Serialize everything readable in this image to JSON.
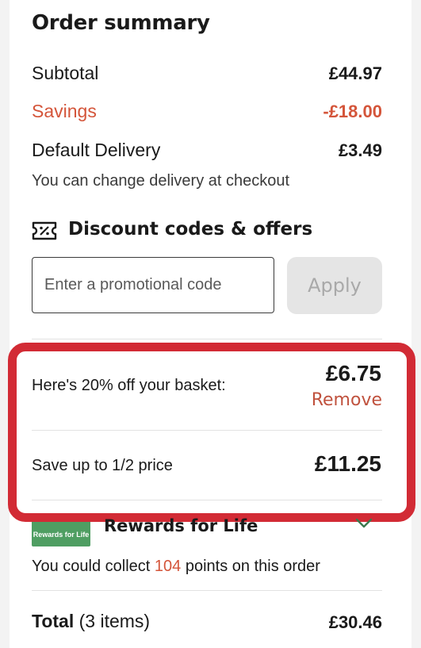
{
  "summary": {
    "title": "Order summary",
    "subtotal_label": "Subtotal",
    "subtotal_value": "£44.97",
    "savings_label": "Savings",
    "savings_value": "-£18.00",
    "delivery_label": "Default Delivery",
    "delivery_value": "£3.49",
    "delivery_note": "You can change delivery at checkout"
  },
  "discounts": {
    "title": "Discount codes & offers",
    "icon": "discount-ticket-icon",
    "promo_placeholder": "Enter a promotional code",
    "apply_label": "Apply"
  },
  "offers": [
    {
      "label": "Here's 20% off your basket:",
      "value": "£6.75",
      "action": "Remove"
    },
    {
      "label": "Save up to 1/2 price",
      "value": "£11.25"
    }
  ],
  "rewards": {
    "logo_text": "Rewards for Life",
    "title": "Rewards for Life",
    "points_prefix": "You could collect ",
    "points_value": "104",
    "points_suffix": " points on this order",
    "chevron_icon": "chevron-down-icon"
  },
  "total": {
    "label": "Total",
    "items": "(3 items)",
    "value": "£30.46"
  },
  "colors": {
    "savings": "#d4553a",
    "highlight_border": "#d22b35",
    "rewards_green": "#4f9e62",
    "apply_disabled_bg": "#e5e5e5"
  }
}
